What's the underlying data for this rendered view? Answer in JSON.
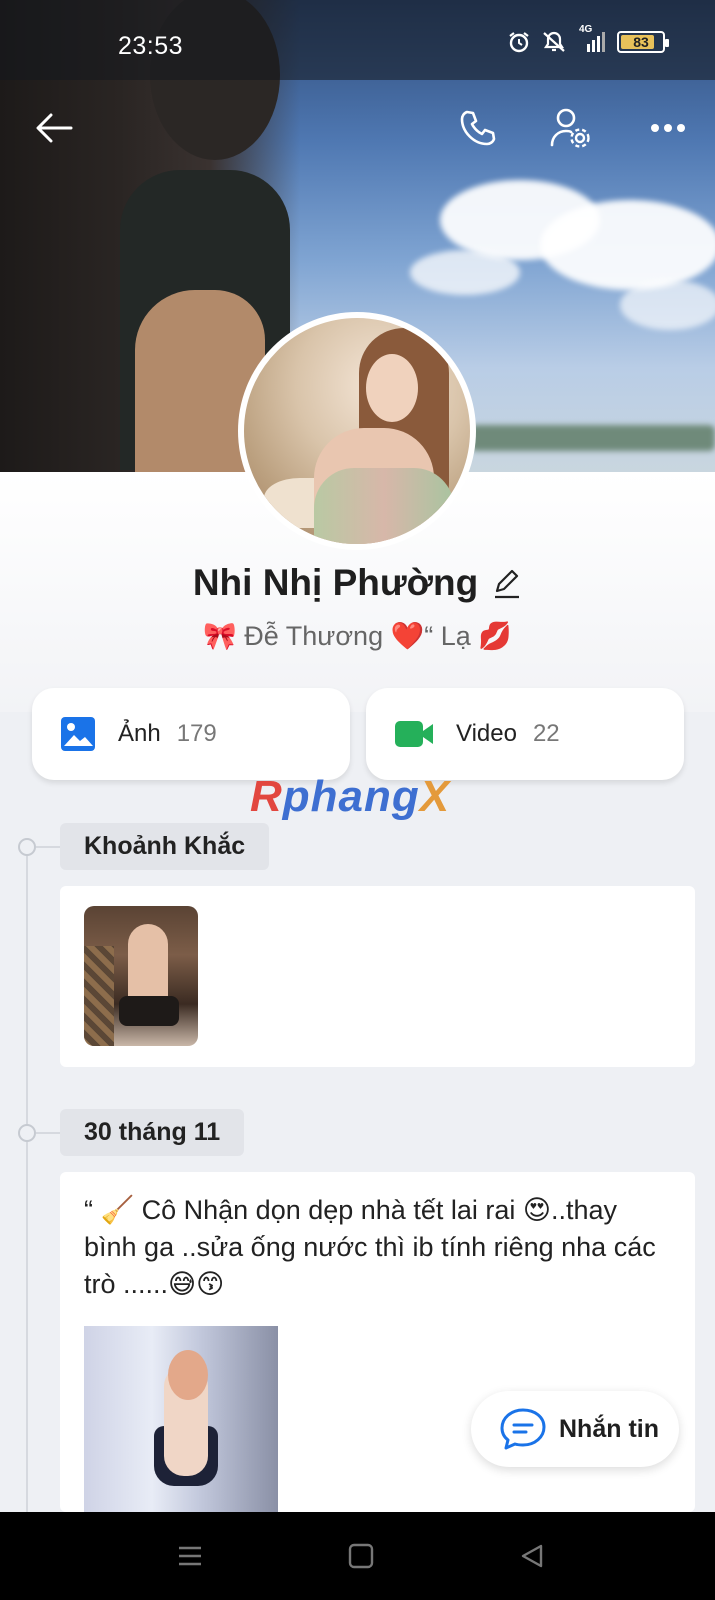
{
  "status_bar": {
    "time": "23:53",
    "network": "4G",
    "battery": "83",
    "battery_level": 0.83,
    "icons": [
      "alarm-icon",
      "mute-icon",
      "signal-icon",
      "battery-icon"
    ]
  },
  "header": {
    "back_icon": "arrow-left-icon",
    "call_icon": "phone-icon",
    "settings_icon": "user-settings-icon",
    "more_icon": "more-dots-icon"
  },
  "profile": {
    "name": "Nhi Nhị Phường",
    "edit_icon": "pencil-icon",
    "bio": "🎀  Đễ Thương ❤️“ Lạ 💋"
  },
  "media": {
    "photos": {
      "label": "Ảnh",
      "count": "179",
      "icon": "image-icon",
      "color": "#1a73e8"
    },
    "videos": {
      "label": "Video",
      "count": "22",
      "icon": "video-icon",
      "color": "#25b05a"
    }
  },
  "watermark": {
    "part1": "R",
    "part2": "phang",
    "part3": "X"
  },
  "timeline": {
    "moments_label": "Khoảnh Khắc",
    "date_label": "30 tháng 11",
    "post_text": "“ 🧹 Cô Nhận dọn dẹp nhà tết lai rai 😍..thay bình ga ..sửa ống nước thì  ib tính riêng  nha các trò ......😅😙"
  },
  "fab": {
    "label": "Nhắn tin",
    "icon": "chat-bubble-icon"
  },
  "navbar": {
    "icons": [
      "menu-icon",
      "home-icon",
      "back-icon"
    ]
  },
  "colors": {
    "accent_blue": "#1a73e8",
    "accent_green": "#25b05a"
  }
}
